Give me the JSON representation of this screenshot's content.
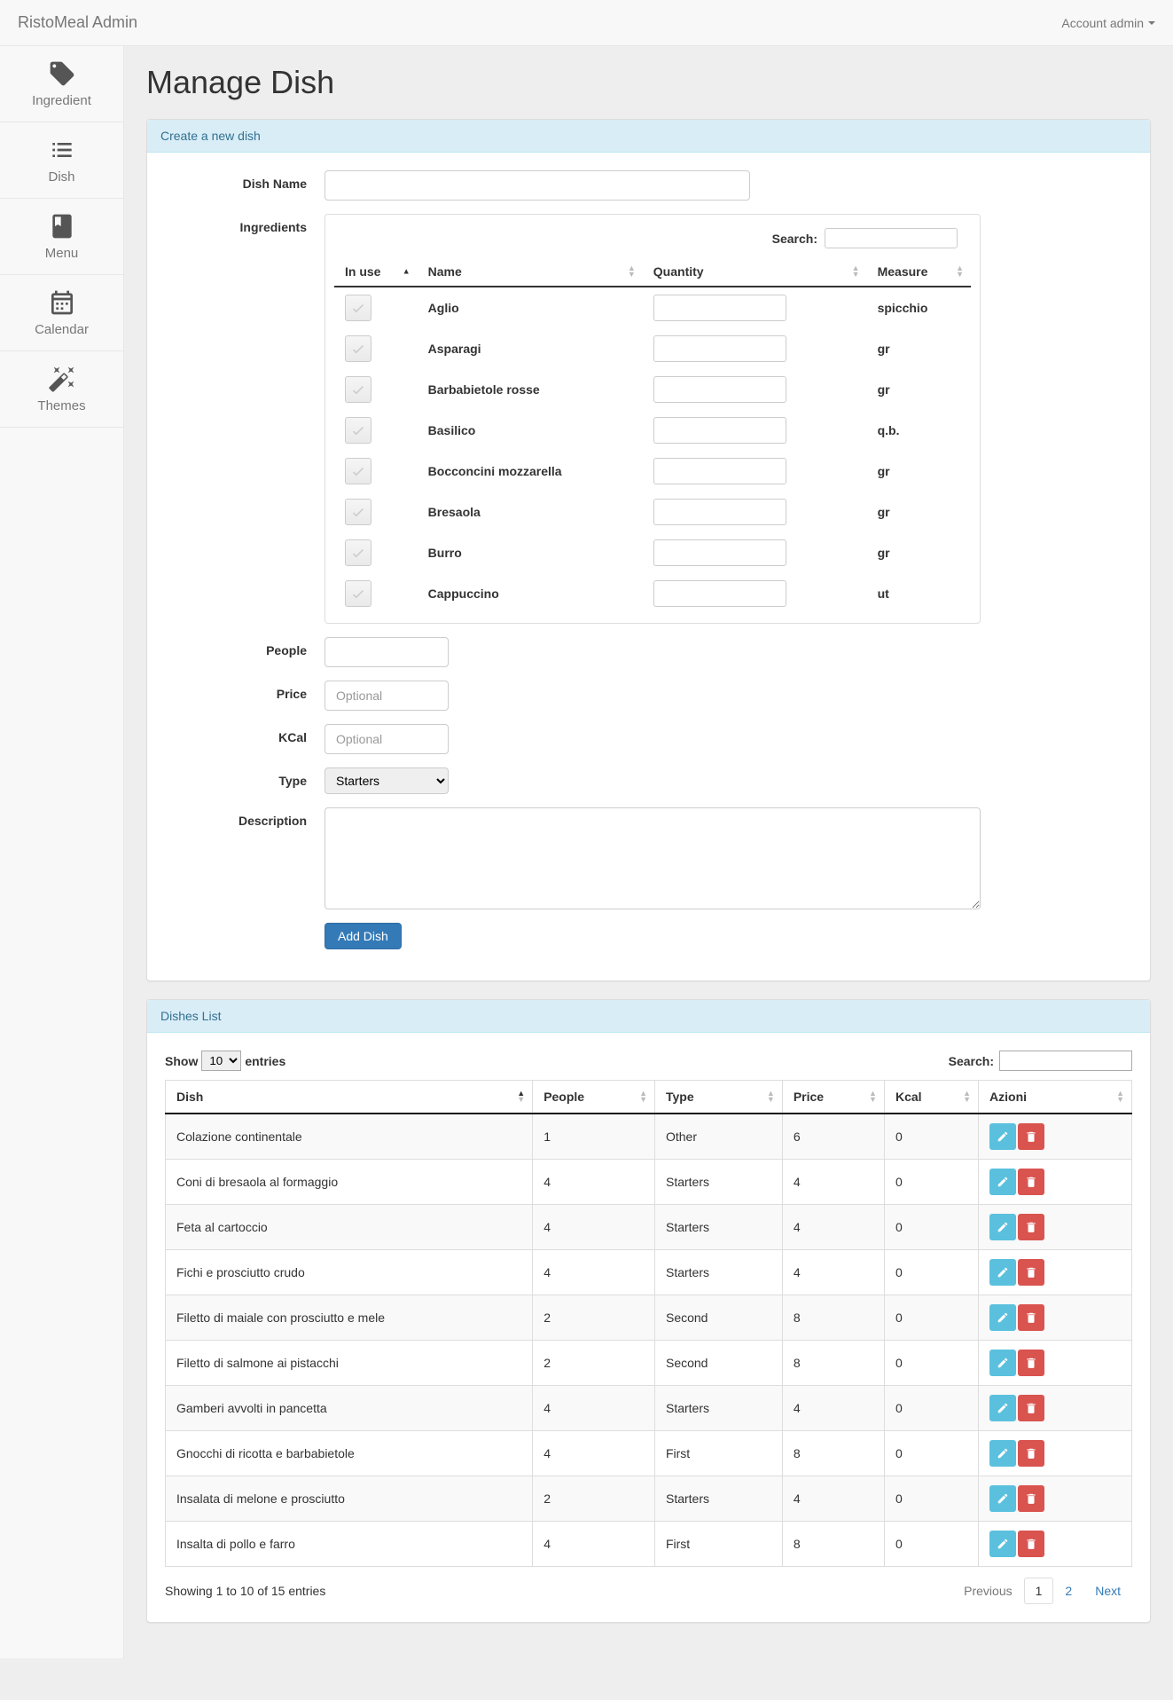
{
  "navbar": {
    "brand": "RistoMeal Admin",
    "account": "Account admin"
  },
  "sidebar": {
    "items": [
      {
        "label": "Ingredient"
      },
      {
        "label": "Dish"
      },
      {
        "label": "Menu"
      },
      {
        "label": "Calendar"
      },
      {
        "label": "Themes"
      }
    ]
  },
  "page": {
    "title": "Manage Dish"
  },
  "create_panel": {
    "header": "Create a new dish",
    "labels": {
      "dish_name": "Dish Name",
      "ingredients": "Ingredients",
      "people": "People",
      "price": "Price",
      "kcal": "KCal",
      "type": "Type",
      "description": "Description"
    },
    "placeholders": {
      "price": "Optional",
      "kcal": "Optional"
    },
    "type_value": "Starters",
    "add_button": "Add Dish",
    "ing_search_label": "Search:",
    "ing_headers": {
      "in_use": "In use",
      "name": "Name",
      "quantity": "Quantity",
      "measure": "Measure"
    },
    "ingredients_list": [
      {
        "name": "Aglio",
        "measure": "spicchio"
      },
      {
        "name": "Asparagi",
        "measure": "gr"
      },
      {
        "name": "Barbabietole rosse",
        "measure": "gr"
      },
      {
        "name": "Basilico",
        "measure": "q.b."
      },
      {
        "name": "Bocconcini mozzarella",
        "measure": "gr"
      },
      {
        "name": "Bresaola",
        "measure": "gr"
      },
      {
        "name": "Burro",
        "measure": "gr"
      },
      {
        "name": "Cappuccino",
        "measure": "ut"
      }
    ]
  },
  "list_panel": {
    "header": "Dishes List",
    "length_show": "Show",
    "length_entries": "entries",
    "length_value": "10",
    "search_label": "Search:",
    "headers": {
      "dish": "Dish",
      "people": "People",
      "type": "Type",
      "price": "Price",
      "kcal": "Kcal",
      "azioni": "Azioni"
    },
    "rows": [
      {
        "dish": "Colazione continentale",
        "people": "1",
        "type": "Other",
        "price": "6",
        "kcal": "0"
      },
      {
        "dish": "Coni di bresaola al formaggio",
        "people": "4",
        "type": "Starters",
        "price": "4",
        "kcal": "0"
      },
      {
        "dish": "Feta al cartoccio",
        "people": "4",
        "type": "Starters",
        "price": "4",
        "kcal": "0"
      },
      {
        "dish": "Fichi e prosciutto crudo",
        "people": "4",
        "type": "Starters",
        "price": "4",
        "kcal": "0"
      },
      {
        "dish": "Filetto di maiale con prosciutto e mele",
        "people": "2",
        "type": "Second",
        "price": "8",
        "kcal": "0"
      },
      {
        "dish": "Filetto di salmone ai pistacchi",
        "people": "2",
        "type": "Second",
        "price": "8",
        "kcal": "0"
      },
      {
        "dish": "Gamberi avvolti in pancetta",
        "people": "4",
        "type": "Starters",
        "price": "4",
        "kcal": "0"
      },
      {
        "dish": "Gnocchi di ricotta e barbabietole",
        "people": "4",
        "type": "First",
        "price": "8",
        "kcal": "0"
      },
      {
        "dish": "Insalata di melone e prosciutto",
        "people": "2",
        "type": "Starters",
        "price": "4",
        "kcal": "0"
      },
      {
        "dish": "Insalta di pollo e farro",
        "people": "4",
        "type": "First",
        "price": "8",
        "kcal": "0"
      }
    ],
    "info": "Showing 1 to 10 of 15 entries",
    "pagination": {
      "previous": "Previous",
      "next": "Next",
      "pages": [
        "1",
        "2"
      ],
      "active": "1"
    }
  }
}
